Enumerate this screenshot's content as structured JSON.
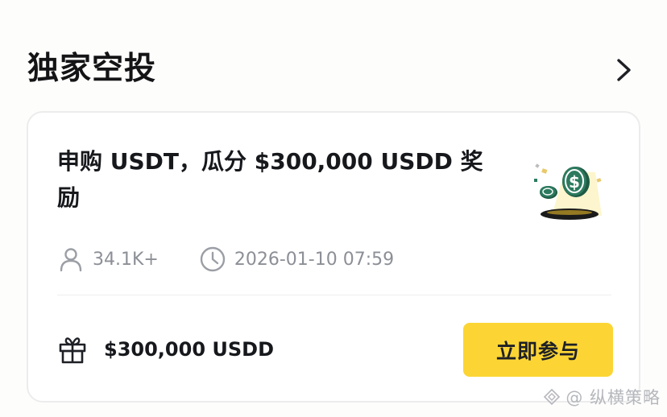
{
  "section": {
    "title": "独家空投"
  },
  "card": {
    "title": "申购 USDT，瓜分 $300,000 USDD 奖励",
    "participants": "34.1K+",
    "datetime": "2026-01-10 07:59",
    "reward": "$300,000 USDD",
    "button_label": "立即参与"
  },
  "watermark": {
    "text": "@ 纵横策略"
  },
  "icons": {
    "chevron": "chevron-right-icon",
    "user": "user-icon",
    "clock": "clock-icon",
    "gift": "gift-icon",
    "illustration": "airdrop-coins-illustration"
  },
  "colors": {
    "accent": "#fcd535",
    "coin_green": "#2d7a5f"
  }
}
